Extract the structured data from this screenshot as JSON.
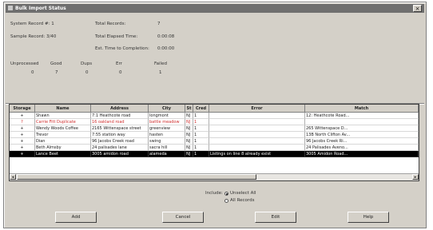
{
  "window": {
    "title": "Bulk Import Status"
  },
  "summary": {
    "system_record_label": "System Record #: 1",
    "sample_record_label": "Sample Record: 3/40",
    "total_records_label": "Total Records:",
    "total_records_value": "7",
    "total_elapsed_label": "Total Elapsed Time:",
    "total_elapsed_value": "0:00:08",
    "est_completion_label": "Est. Time to Completion:",
    "est_completion_value": "0:00:00"
  },
  "counts": {
    "headers": [
      "Unprocessed",
      "Good",
      "Dups",
      "Err",
      "Failed"
    ],
    "values": [
      "0",
      "7",
      "0",
      "0",
      "1"
    ]
  },
  "grid": {
    "columns": [
      "Storage",
      "Name",
      "Address",
      "City",
      "St",
      "Cred",
      "Error",
      "Match"
    ],
    "rows": [
      [
        "+",
        "Shawn",
        "7:1 Heathcote road",
        "longmont",
        "NJ",
        "1",
        "",
        "12: Heathcote Road..."
      ],
      [
        "?",
        "Carrie Fitt Duplicate",
        "16 oakland road",
        "battle meadow",
        "NJ",
        "1",
        "",
        ""
      ],
      [
        "+",
        "Wendy Woods Coffee",
        "2165 Wittenspace street",
        "greenview",
        "NJ",
        "1",
        "",
        "265 Wittenspace D..."
      ],
      [
        "+",
        "Trevor",
        "7:55 station way",
        "hasten",
        "NJ",
        "1",
        "",
        "13B North Clifton Av..."
      ],
      [
        "+",
        "Dian",
        "96 Jacobs Creek road",
        "swing",
        "NJ",
        "1",
        "",
        "96 Jacobs Creek Ri..."
      ],
      [
        "+",
        "Beth Almsby",
        "24 palisades lane",
        "sacra hill",
        "NJ",
        "1",
        "",
        "24 Palisades Aveno..."
      ],
      [
        "+",
        "Lance Beet",
        "3005 amidon road",
        "alameda",
        "NJ",
        "1",
        "Listings on line 8 already exist",
        "3005 Amidon Road..."
      ]
    ]
  },
  "include": {
    "label": "Include:",
    "options": [
      "Unselect All",
      "All Records"
    ]
  },
  "buttons": {
    "add": "Add",
    "cancel": "Cancel",
    "edit": "Edit",
    "help": "Help"
  }
}
